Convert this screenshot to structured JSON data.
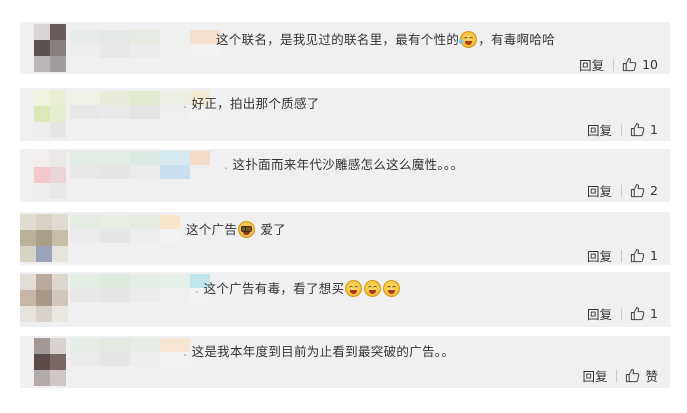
{
  "comments": [
    {
      "text_before": "这个联名，是我见过的联名里，最有个性的",
      "emoji": "laughing-tears-emoji",
      "text_after": "，有毒啊哈哈",
      "reply": "回复",
      "likes": "10"
    },
    {
      "text": "好正，拍出那个质感了",
      "reply": "回复",
      "likes": "1"
    },
    {
      "text": "这扑面而来年代沙雕感怎么这么魔性。。。",
      "reply": "回复",
      "likes": "2"
    },
    {
      "text_before": "这个广告",
      "emoji": "sunglasses-emoji",
      "text_after": "爱了",
      "reply": "回复",
      "likes": "1"
    },
    {
      "text_before": "这个广告有毒，看了想买",
      "emojis": [
        "heart-eyes-emoji",
        "heart-eyes-emoji",
        "heart-eyes-emoji"
      ],
      "reply": "回复",
      "likes": "1"
    },
    {
      "text": "这是我本年度到目前为止看到最突破的广告。。",
      "reply": "回复",
      "likes": "赞"
    }
  ]
}
